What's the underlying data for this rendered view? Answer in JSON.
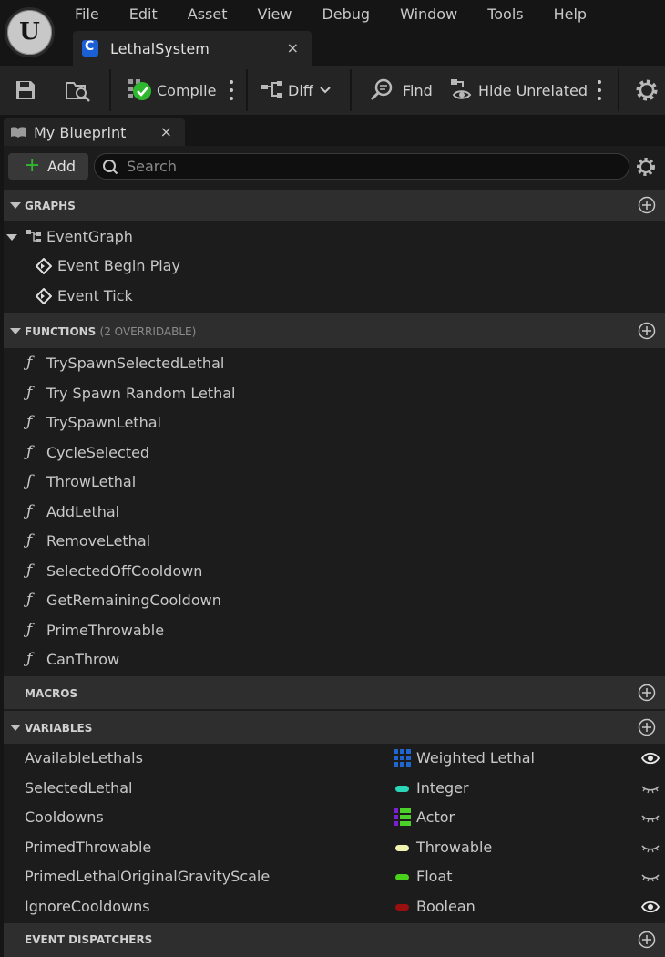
{
  "menu": [
    "File",
    "Edit",
    "Asset",
    "View",
    "Debug",
    "Window",
    "Tools",
    "Help"
  ],
  "document_tab": {
    "label": "LethalSystem",
    "close": "×"
  },
  "toolbar": {
    "compile_label": "Compile",
    "diff_label": "Diff",
    "find_label": "Find",
    "hide_unrelated_label": "Hide Unrelated"
  },
  "panel_tab": {
    "label": "My Blueprint",
    "close": "×"
  },
  "add_button": {
    "label": "Add",
    "plus": "+"
  },
  "search": {
    "placeholder": "Search"
  },
  "sections": {
    "graphs": {
      "title": "GRAPHS"
    },
    "functions": {
      "title": "FUNCTIONS",
      "subtitle": "(2 OVERRIDABLE)"
    },
    "macros": {
      "title": "MACROS"
    },
    "variables": {
      "title": "VARIABLES"
    },
    "event_dispatchers": {
      "title": "EVENT DISPATCHERS"
    }
  },
  "graphs": {
    "event_graph": "EventGraph",
    "events": [
      "Event Begin Play",
      "Event Tick"
    ]
  },
  "functions": [
    "TrySpawnSelectedLethal",
    "Try Spawn Random Lethal",
    "TrySpawnLethal",
    "CycleSelected",
    "ThrowLethal",
    "AddLethal",
    "RemoveLethal",
    "SelectedOffCooldown",
    "GetRemainingCooldown",
    "PrimeThrowable",
    "CanThrow"
  ],
  "function_icon": "ƒ",
  "variables": [
    {
      "name": "AvailableLethals",
      "type": "Weighted Lethal",
      "type_icon": "map-grid-icon",
      "color": "#1f66d1",
      "visible": true
    },
    {
      "name": "SelectedLethal",
      "type": "Integer",
      "type_icon": "pill-icon",
      "color": "#2bd6b8",
      "visible": false
    },
    {
      "name": "Cooldowns",
      "type": "Actor",
      "type_icon": "map-icon",
      "color": "#4cd12a",
      "key_color": "#7a1fd1",
      "visible": false
    },
    {
      "name": "PrimedThrowable",
      "type": "Throwable",
      "type_icon": "pill-icon",
      "color": "#f0f3b0",
      "visible": false
    },
    {
      "name": "PrimedLethalOriginalGravityScale",
      "type": "Float",
      "type_icon": "pill-icon",
      "color": "#48d21a",
      "visible": false
    },
    {
      "name": "IgnoreCooldowns",
      "type": "Boolean",
      "type_icon": "pill-icon",
      "color": "#9a0f0f",
      "visible": true
    }
  ],
  "colors": {
    "background": "#151515",
    "panel": "#1c1c1c",
    "section_header": "#2e2e2e",
    "accent_green": "#2fb82f",
    "blueprint_blue": "#1b5fd6"
  }
}
